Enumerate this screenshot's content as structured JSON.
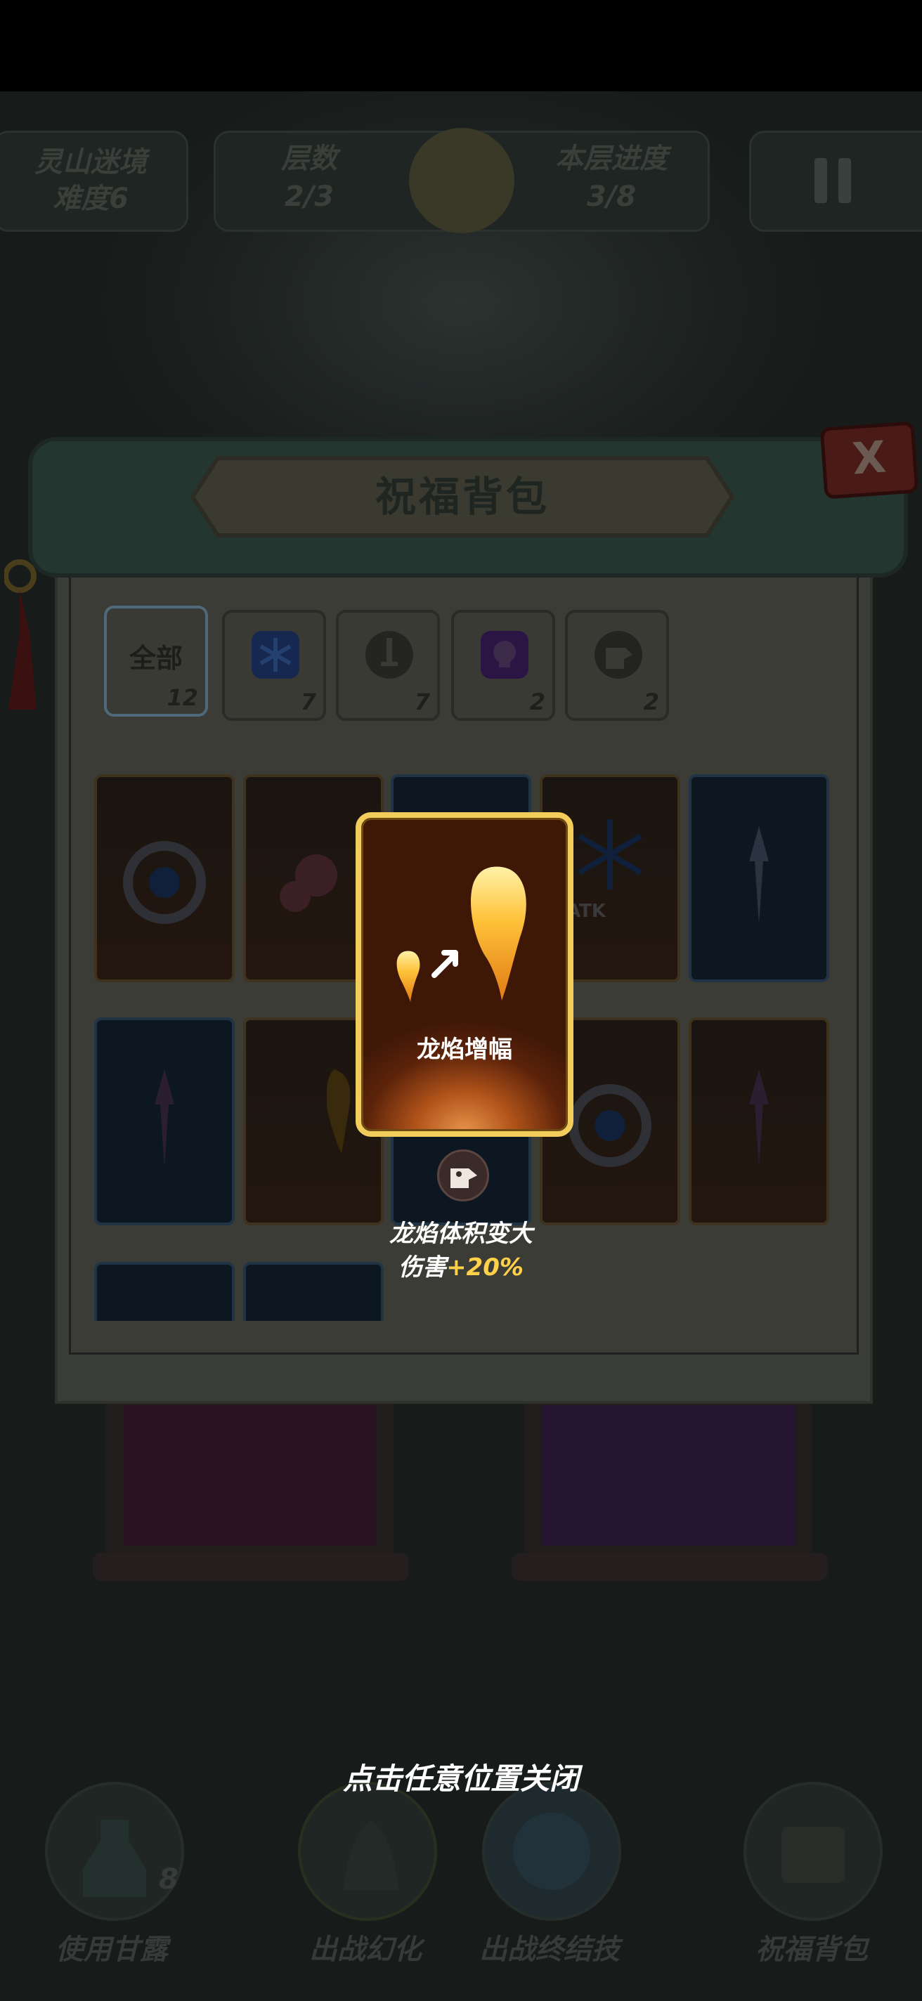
{
  "hud": {
    "location": "灵山迷境",
    "difficulty": "难度6",
    "floor_label": "层数",
    "floor_value": "2/3",
    "progress_label": "本层进度",
    "progress_value": "3/8"
  },
  "backpack": {
    "title": "祝福背包",
    "close_glyph": "X",
    "tabs": [
      {
        "label": "全部",
        "count": "12",
        "icon": "all"
      },
      {
        "label": "",
        "count": "7",
        "icon": "snowflake-icon"
      },
      {
        "label": "",
        "count": "7",
        "icon": "sword-icon"
      },
      {
        "label": "",
        "count": "2",
        "icon": "skull-icon"
      },
      {
        "label": "",
        "count": "2",
        "icon": "dragon-icon"
      }
    ],
    "visible_slot_text": "ATK"
  },
  "popup": {
    "name": "龙焰增幅",
    "desc_line1": "龙焰体积变大",
    "desc_line2_prefix": "伤害",
    "desc_line2_value": "+20%"
  },
  "close_hint": "点击任意位置关闭",
  "bottom_bar": {
    "items": [
      {
        "label": "使用甘露",
        "badge": "8"
      },
      {
        "label": "出战幻化"
      },
      {
        "label": "出战终结技"
      },
      {
        "label": "祝福背包"
      }
    ]
  },
  "colors": {
    "popup_border": "#f3cd5c",
    "highlight_value": "#ffd04a",
    "overlay": "#0d0f0f"
  }
}
